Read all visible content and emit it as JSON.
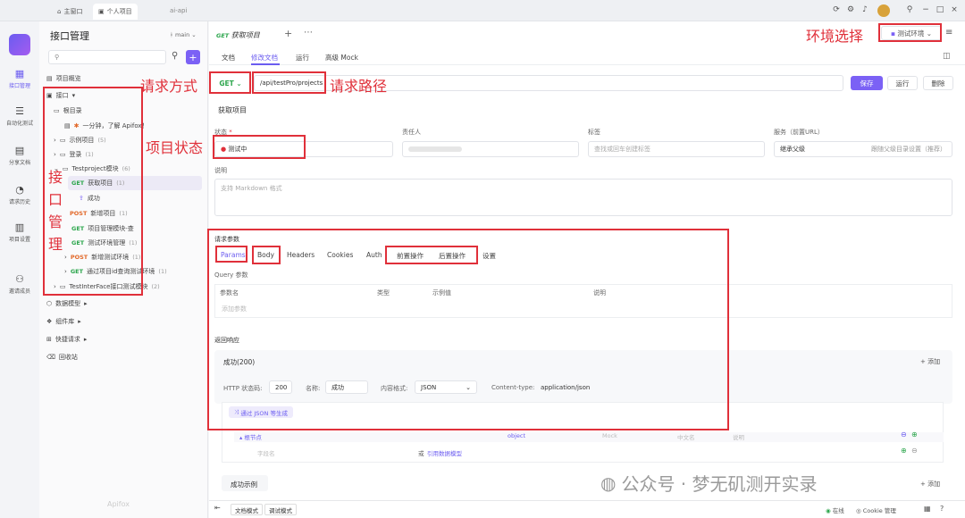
{
  "titlebar": {
    "tabs": [
      {
        "label": "主窗口"
      },
      {
        "label": "个人项目"
      }
    ],
    "project": "ai-api"
  },
  "iconbar": {
    "items": [
      {
        "label": "接口管理",
        "icon": "api-icon"
      },
      {
        "label": "自动化测试",
        "icon": "test-icon"
      },
      {
        "label": "分享文档",
        "icon": "share-icon"
      },
      {
        "label": "请求历史",
        "icon": "history-icon"
      },
      {
        "label": "项目设置",
        "icon": "settings-icon"
      },
      {
        "label": "邀请成员",
        "icon": "invite-icon"
      }
    ]
  },
  "sidebar": {
    "title": "接口管理",
    "branch": "main",
    "overview": "项目概览",
    "api_root": "接口",
    "tree": {
      "root": "根目录",
      "intro": "一分钟，了解 Apifox！",
      "example": "示例项目",
      "example_count": "(5)",
      "login": "登录",
      "login_count": "(1)",
      "module": "Testproject模块",
      "module_count": "(6)",
      "items": [
        {
          "method": "GET",
          "name": "获取项目",
          "count": "(1)"
        },
        {
          "method": "",
          "name": "成功",
          "count": ""
        },
        {
          "method": "POST",
          "name": "新增项目",
          "count": "(1)"
        },
        {
          "method": "GET",
          "name": "项目管理模块-查",
          "count": ""
        },
        {
          "method": "GET",
          "name": "测试环境管理",
          "count": "(1)"
        },
        {
          "method": "POST",
          "name": "新增测试环境",
          "count": "(1)"
        },
        {
          "method": "GET",
          "name": "通过项目id查询测试环境",
          "count": "(1)"
        }
      ],
      "iface": "TestInterFace接口测试模块",
      "iface_count": "(2)"
    },
    "bottom": [
      "数据模型",
      "组件库",
      "快捷请求",
      "回收站"
    ],
    "logo": "Apifox"
  },
  "header": {
    "tab_method": "GET",
    "tab_name": "获取项目",
    "env": "测试环境",
    "subtabs": [
      "文档",
      "修改文档",
      "运行",
      "高级 Mock"
    ]
  },
  "request": {
    "method": "GET",
    "path": "/api/testPro/projects",
    "save": "保存",
    "run": "运行",
    "delete": "删除",
    "name": "获取项目"
  },
  "fields": {
    "status_label": "状态",
    "status_value": "测试中",
    "owner_label": "责任人",
    "tags_label": "标签",
    "tags_placeholder": "查找或回车创建标签",
    "service_label": "服务（前置URL）",
    "service_value": "继承父级",
    "service_hint": "跟随父级目录设置（推荐）",
    "desc_label": "说明",
    "desc_placeholder": "支持 Markdown 格式"
  },
  "params": {
    "section": "请求参数",
    "tabs": [
      "Params",
      "Body",
      "Headers",
      "Cookies",
      "Auth",
      "前置操作",
      "后置操作",
      "设置"
    ],
    "query_label": "Query 参数",
    "columns": [
      "参数名",
      "类型",
      "示例值",
      "说明"
    ],
    "add_placeholder": "添加参数"
  },
  "response": {
    "section": "返回响应",
    "tab": "成功(200)",
    "add": "+ 添加",
    "http_code_label": "HTTP 状态码:",
    "http_code": "200",
    "name_label": "名称:",
    "name_value": "成功",
    "format_label": "内容格式:",
    "format_value": "JSON",
    "content_type_label": "Content-type:",
    "content_type": "application/json",
    "gen_button": "通过 JSON 等生成",
    "root_node": "根节点",
    "root_type": "object",
    "mock": "Mock",
    "cn_name": "中文名",
    "desc": "说明",
    "field_placeholder": "字段名",
    "or": "或",
    "ref_model": "引用数据模型",
    "example_tab": "成功示例",
    "example_add": "+ 添加"
  },
  "footer": {
    "doc_mode": "文档模式",
    "debug_mode": "调试模式",
    "online": "在线",
    "cookie": "Cookie 管理"
  },
  "annotations": {
    "method": "请求方式",
    "path": "请求路径",
    "env": "环境选择",
    "status": "项目状态",
    "api_mgmt": [
      "接",
      "口",
      "管",
      "理"
    ]
  },
  "watermark": "公众号 · 梦无矶测开实录"
}
